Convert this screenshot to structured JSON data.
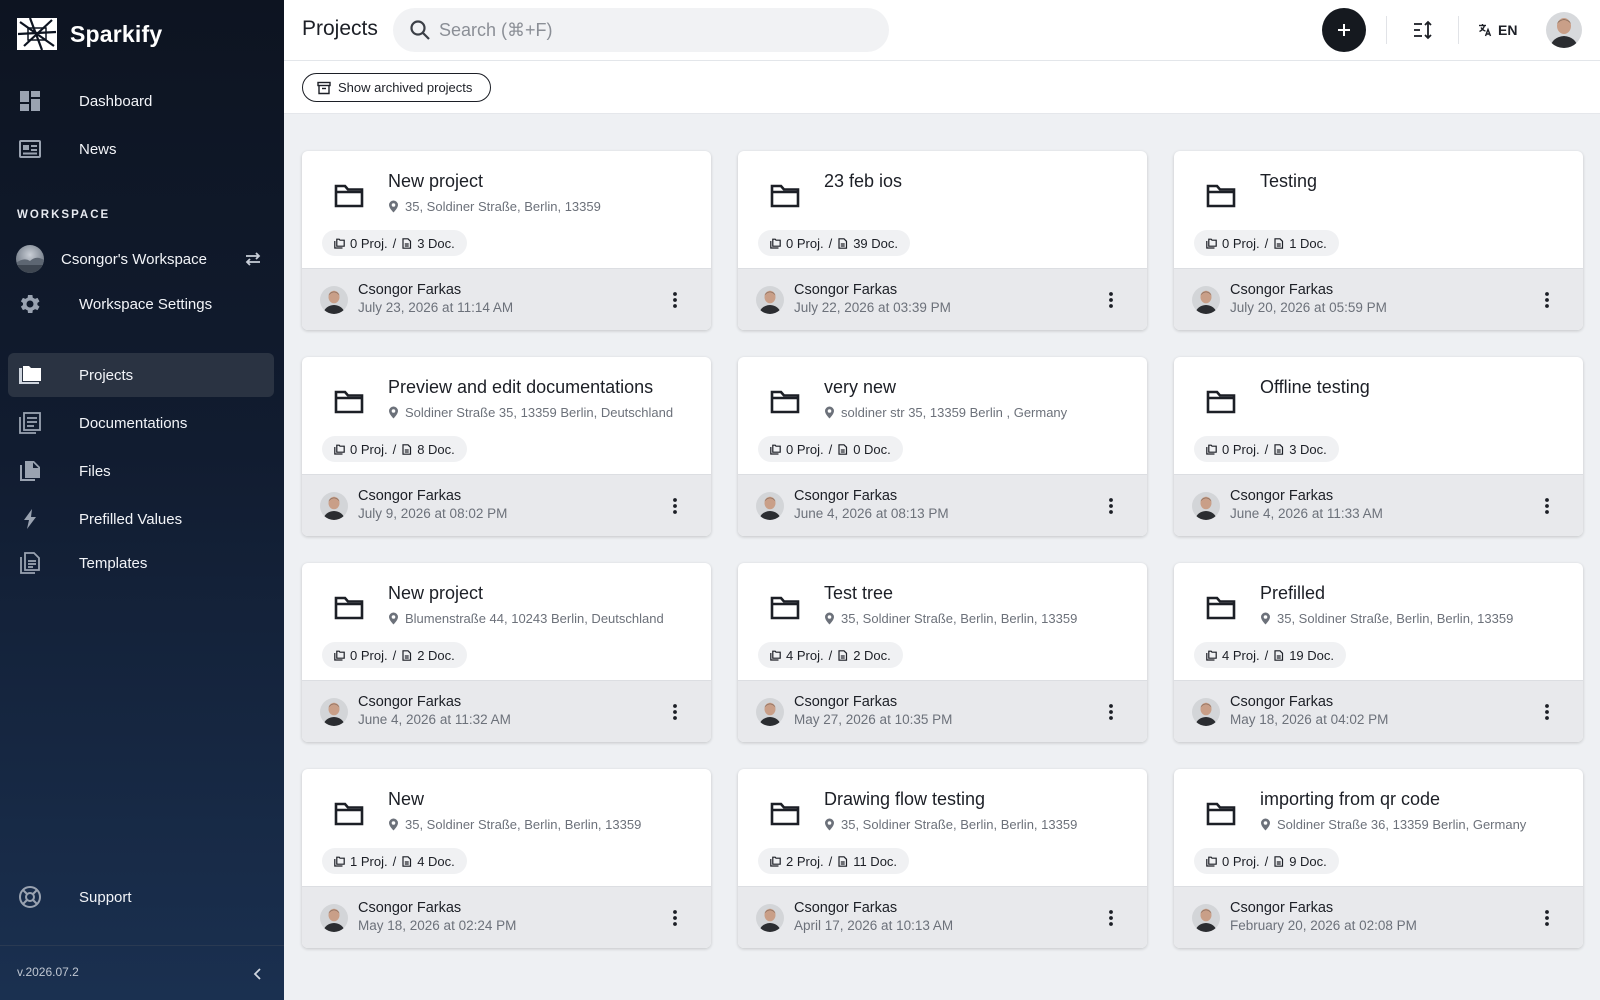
{
  "app": {
    "name": "Sparkify",
    "version": "v.2026.07.2"
  },
  "sidebar": {
    "top_items": [
      {
        "label": "Dashboard",
        "icon": "dashboard-icon"
      },
      {
        "label": "News",
        "icon": "news-icon"
      }
    ],
    "section_label": "WORKSPACE",
    "workspace": {
      "name": "Csongor's Workspace"
    },
    "workspace_settings_label": "Workspace Settings",
    "items": [
      {
        "label": "Projects",
        "icon": "folder-icon",
        "active": true
      },
      {
        "label": "Documentations",
        "icon": "documents-icon"
      },
      {
        "label": "Files",
        "icon": "file-icon"
      },
      {
        "label": "Prefilled Values",
        "icon": "bolt-icon"
      },
      {
        "label": "Templates",
        "icon": "template-icon"
      }
    ],
    "support_label": "Support"
  },
  "header": {
    "title": "Projects",
    "search_placeholder": "Search (⌘+F)",
    "language": "EN"
  },
  "toolbar": {
    "archived_label": "Show archived projects"
  },
  "projects": [
    {
      "title": "New project",
      "address": "35, Soldiner Straße, Berlin, 13359",
      "counts": "0 Proj.  /  3 Doc.",
      "proj": "0 Proj.",
      "doc": "3 Doc.",
      "owner": "Csongor Farkas",
      "date": "July 23, 2026 at 11:14 AM"
    },
    {
      "title": "23 feb ios",
      "address": "",
      "proj": "0 Proj.",
      "doc": "39 Doc.",
      "owner": "Csongor Farkas",
      "date": "July 22, 2026 at 03:39 PM"
    },
    {
      "title": "Testing",
      "address": "",
      "proj": "0 Proj.",
      "doc": "1 Doc.",
      "owner": "Csongor Farkas",
      "date": "July 20, 2026 at 05:59 PM"
    },
    {
      "title": "Preview and edit documentations",
      "address": "Soldiner Straße 35, 13359 Berlin, Deutschland",
      "proj": "0 Proj.",
      "doc": "8 Doc.",
      "owner": "Csongor Farkas",
      "date": "July 9, 2026 at 08:02 PM"
    },
    {
      "title": "very new",
      "address": "soldiner str 35, 13359 Berlin , Germany",
      "proj": "0 Proj.",
      "doc": "0 Doc.",
      "owner": "Csongor Farkas",
      "date": "June 4, 2026 at 08:13 PM"
    },
    {
      "title": "Offline testing",
      "address": "",
      "proj": "0 Proj.",
      "doc": "3 Doc.",
      "owner": "Csongor Farkas",
      "date": "June 4, 2026 at 11:33 AM"
    },
    {
      "title": "New project",
      "address": "Blumenstraße 44, 10243 Berlin, Deutschland",
      "proj": "0 Proj.",
      "doc": "2 Doc.",
      "owner": "Csongor Farkas",
      "date": "June 4, 2026 at 11:32 AM"
    },
    {
      "title": "Test tree",
      "address": "35, Soldiner Straße, Berlin, Berlin, 13359",
      "proj": "4 Proj.",
      "doc": "2 Doc.",
      "owner": "Csongor Farkas",
      "date": "May 27, 2026 at 10:35 PM"
    },
    {
      "title": "Prefilled",
      "address": "35, Soldiner Straße, Berlin, Berlin, 13359",
      "proj": "4 Proj.",
      "doc": "19 Doc.",
      "owner": "Csongor Farkas",
      "date": "May 18, 2026 at 04:02 PM"
    },
    {
      "title": "New",
      "address": "35, Soldiner Straße, Berlin, Berlin, 13359",
      "proj": "1 Proj.",
      "doc": "4 Doc.",
      "owner": "Csongor Farkas",
      "date": "May 18, 2026 at 02:24 PM"
    },
    {
      "title": "Drawing flow testing",
      "address": "35, Soldiner Straße, Berlin, Berlin, 13359",
      "proj": "2 Proj.",
      "doc": "11 Doc.",
      "owner": "Csongor Farkas",
      "date": "April 17, 2026 at 10:13 AM"
    },
    {
      "title": "importing from qr code",
      "address": "Soldiner Straße 36, 13359 Berlin, Germany",
      "proj": "0 Proj.",
      "doc": "9 Doc.",
      "owner": "Csongor Farkas",
      "date": "February 20, 2026 at 02:08 PM"
    }
  ],
  "colors": {
    "sidebar_top": "#0d1421",
    "sidebar_bottom": "#1a3050",
    "accent": "#15191f",
    "card_footer": "#e8e9ec",
    "page_bg": "#eef0f3"
  }
}
